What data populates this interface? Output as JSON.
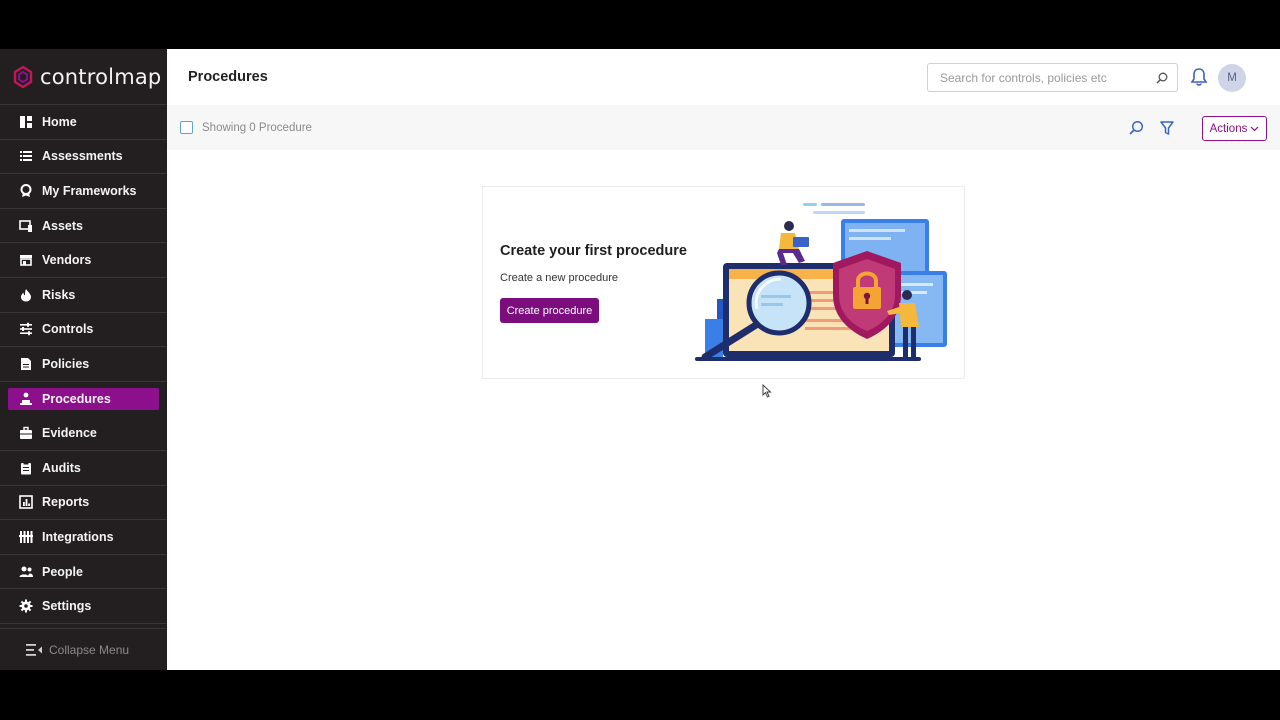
{
  "brand": {
    "name": "controlmap",
    "accent": "#8c0f8c"
  },
  "sidebar": {
    "items": [
      {
        "label": "Home",
        "icon": "home-icon"
      },
      {
        "label": "Assessments",
        "icon": "list-icon"
      },
      {
        "label": "My Frameworks",
        "icon": "badge-icon"
      },
      {
        "label": "Assets",
        "icon": "devices-icon"
      },
      {
        "label": "Vendors",
        "icon": "store-icon"
      },
      {
        "label": "Risks",
        "icon": "flame-icon"
      },
      {
        "label": "Controls",
        "icon": "sliders-icon"
      },
      {
        "label": "Policies",
        "icon": "document-icon"
      },
      {
        "label": "Procedures",
        "icon": "hierarchy-icon",
        "active": true
      },
      {
        "label": "Evidence",
        "icon": "briefcase-icon"
      },
      {
        "label": "Audits",
        "icon": "clipboard-icon"
      },
      {
        "label": "Reports",
        "icon": "chart-icon"
      },
      {
        "label": "Integrations",
        "icon": "integrations-icon"
      },
      {
        "label": "People",
        "icon": "people-icon"
      },
      {
        "label": "Settings",
        "icon": "gear-icon"
      }
    ],
    "collapse_label": "Collapse Menu"
  },
  "header": {
    "title": "Procedures",
    "search_placeholder": "Search for controls, policies etc",
    "avatar_initial": "M"
  },
  "toolbar": {
    "showing_text": "Showing 0 Procedure",
    "actions_label": "Actions"
  },
  "empty_state": {
    "title": "Create your first procedure",
    "subtitle": "Create a new procedure",
    "button_label": "Create procedure"
  }
}
